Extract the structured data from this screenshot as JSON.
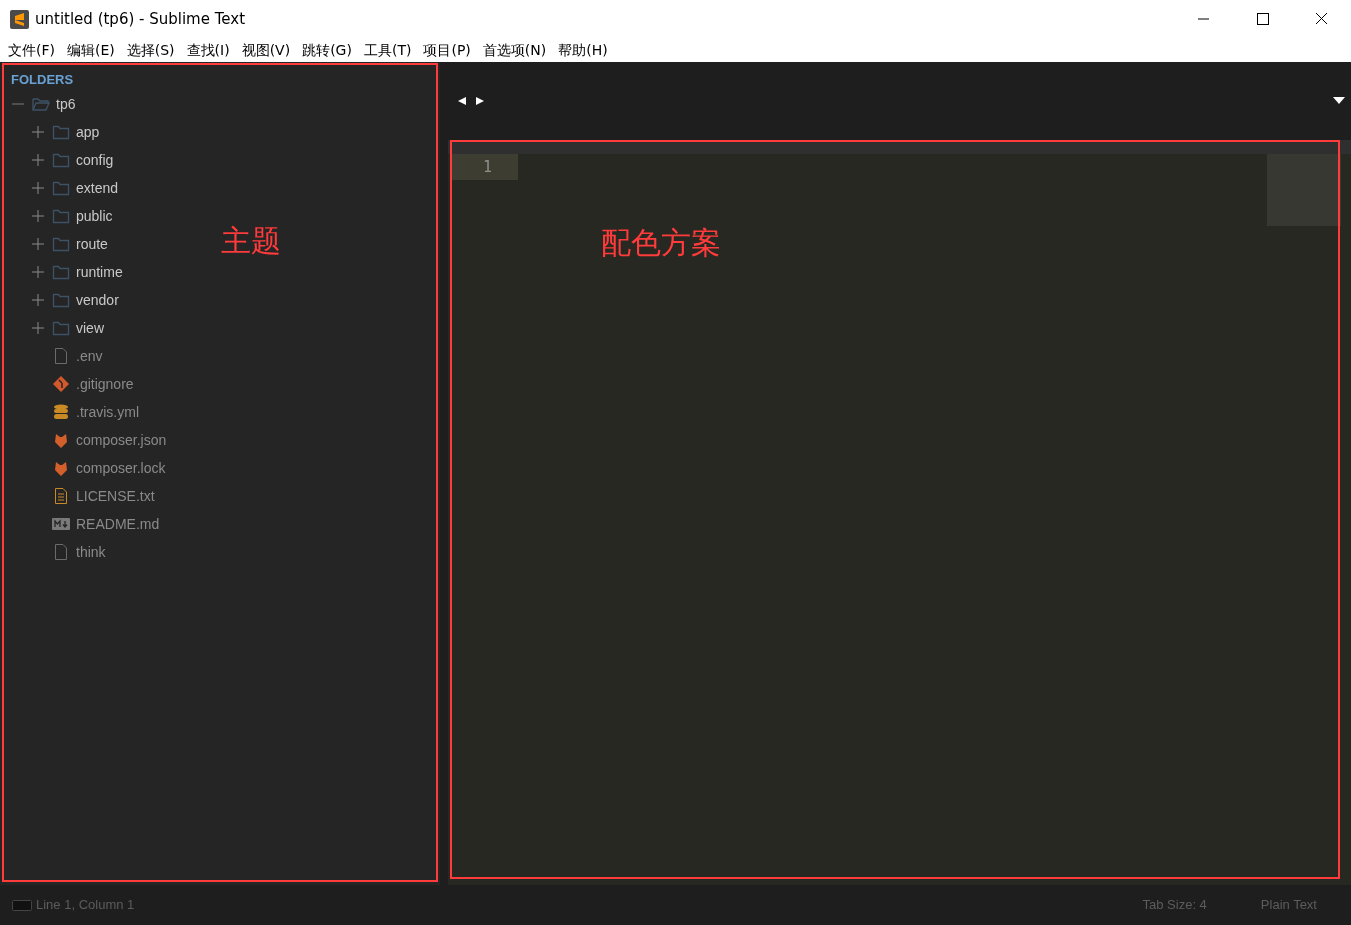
{
  "window": {
    "title": "untitled (tp6) - Sublime Text"
  },
  "menu": [
    "文件(F)",
    "编辑(E)",
    "选择(S)",
    "查找(I)",
    "视图(V)",
    "跳转(G)",
    "工具(T)",
    "项目(P)",
    "首选项(N)",
    "帮助(H)"
  ],
  "sidebar": {
    "heading": "FOLDERS",
    "annotation": {
      "text": "主题",
      "color": "#ff3b3b"
    },
    "tree": [
      {
        "label": "tp6",
        "kind": "folder",
        "expanded": true,
        "children": [
          {
            "label": "app",
            "kind": "folder",
            "expanded": false
          },
          {
            "label": "config",
            "kind": "folder",
            "expanded": false
          },
          {
            "label": "extend",
            "kind": "folder",
            "expanded": false
          },
          {
            "label": "public",
            "kind": "folder",
            "expanded": false
          },
          {
            "label": "route",
            "kind": "folder",
            "expanded": false
          },
          {
            "label": "runtime",
            "kind": "folder",
            "expanded": false
          },
          {
            "label": "vendor",
            "kind": "folder",
            "expanded": false
          },
          {
            "label": "view",
            "kind": "folder",
            "expanded": false
          },
          {
            "label": ".env",
            "kind": "file"
          },
          {
            "label": ".gitignore",
            "kind": "git"
          },
          {
            "label": ".travis.yml",
            "kind": "database"
          },
          {
            "label": "composer.json",
            "kind": "composer"
          },
          {
            "label": "composer.lock",
            "kind": "composer"
          },
          {
            "label": "LICENSE.txt",
            "kind": "text"
          },
          {
            "label": "README.md",
            "kind": "markdown"
          },
          {
            "label": "think",
            "kind": "file"
          }
        ]
      }
    ]
  },
  "editor": {
    "line_numbers": [
      "1"
    ],
    "annotation": {
      "text": "配色方案",
      "color": "#ff3b3b"
    }
  },
  "status_bar": {
    "position": "Line 1, Column 1",
    "tab_size": "Tab Size: 4",
    "syntax": "Plain Text"
  }
}
